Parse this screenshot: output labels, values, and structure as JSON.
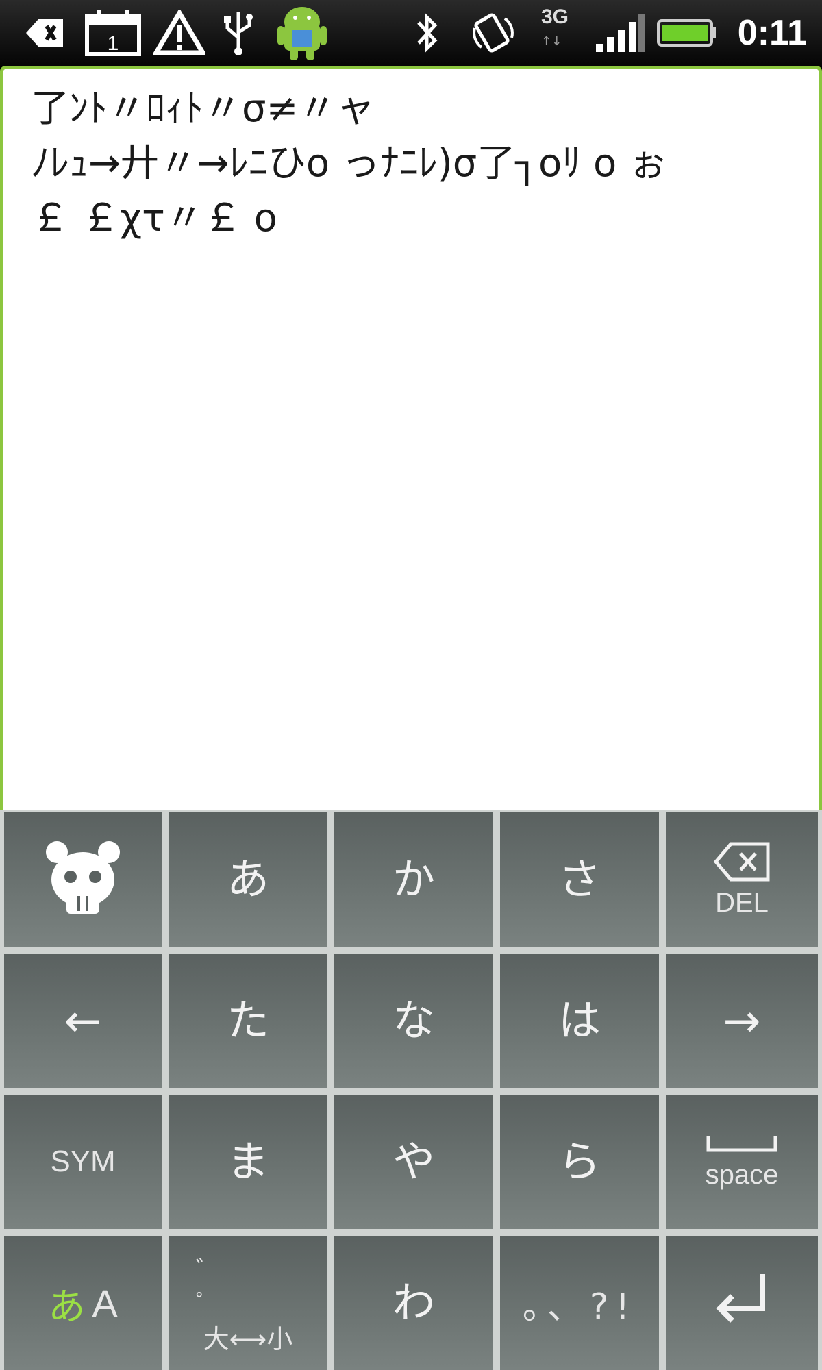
{
  "status_bar": {
    "time": "0:11",
    "network": "3G",
    "network_arrows": "↑↓",
    "icons": [
      "back-arrow-icon",
      "calendar-icon",
      "warning-icon",
      "usb-icon",
      "android-icon",
      "bluetooth-icon",
      "rotate-icon",
      "signal-icon",
      "battery-icon"
    ],
    "calendar_day": "1"
  },
  "text_area": {
    "content": "了ﾝﾄ〃ﾛｨﾄ〃σ≠〃ャ\nﾉﾚｭ→廾〃→ﾚﾆひo っﾅﾆﾚ)σ了┐oﾘ o ぉ\n￡ ￡χτ〃￡ o"
  },
  "keyboard": {
    "rows": [
      [
        {
          "id": "emoji",
          "label": "",
          "icon": "emoji-face-icon"
        },
        {
          "id": "a",
          "label": "あ"
        },
        {
          "id": "ka",
          "label": "か"
        },
        {
          "id": "sa",
          "label": "さ"
        },
        {
          "id": "del",
          "label": "DEL",
          "icon": "backspace-icon"
        }
      ],
      [
        {
          "id": "left",
          "label": "←"
        },
        {
          "id": "ta",
          "label": "た"
        },
        {
          "id": "na",
          "label": "な"
        },
        {
          "id": "ha",
          "label": "は"
        },
        {
          "id": "right",
          "label": "→"
        }
      ],
      [
        {
          "id": "sym",
          "label": "SYM"
        },
        {
          "id": "ma",
          "label": "ま"
        },
        {
          "id": "ya",
          "label": "や"
        },
        {
          "id": "ra",
          "label": "ら"
        },
        {
          "id": "space",
          "label": "space",
          "icon": "space-bar-icon"
        }
      ],
      [
        {
          "id": "mode",
          "label_kana": "あ",
          "label_alpha": "A"
        },
        {
          "id": "case",
          "label_top": "゛ ゜",
          "label_bottom": "大⟷小"
        },
        {
          "id": "wa",
          "label": "わ"
        },
        {
          "id": "punct",
          "label": "。、?!"
        },
        {
          "id": "enter",
          "label": "",
          "icon": "enter-icon"
        }
      ]
    ],
    "accent_color": "#8cc63f"
  }
}
